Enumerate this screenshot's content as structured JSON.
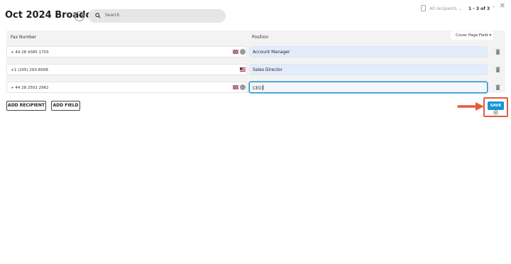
{
  "window": {
    "close_icon": "close-icon"
  },
  "header": {
    "title": "Oct 2024 Broadc...",
    "more_icon": "more-icon",
    "search_placeholder": "Search",
    "recipients_filter": "All recipients ⌄",
    "page_count": "1 - 3 of 3",
    "prev_icon": "chevron-left-icon",
    "next_icon": "chevron-right-icon"
  },
  "table": {
    "columns": {
      "fax": "Fax Number",
      "position": "Position"
    },
    "cover_page_field": "Cover Page Field ▾",
    "rows": [
      {
        "fax": "+ 44 28 4385 1703",
        "flag": "uk-flag-icon",
        "position": "Account Manager"
      },
      {
        "fax": "+1 (205) 293-8008",
        "flag": "us-flag-icon",
        "position": "Sales Director"
      },
      {
        "fax": "+ 44 28 2502 2962",
        "flag": "uk-flag-icon",
        "position": "CEO"
      }
    ]
  },
  "actions": {
    "add_recipient": "ADD RECIPIENT",
    "add_field": "ADD FIELD",
    "save": "SAVE"
  },
  "colors": {
    "accent": "#1594d6",
    "highlight": "#e25b3d",
    "position_bg": "#e3ecfa"
  }
}
